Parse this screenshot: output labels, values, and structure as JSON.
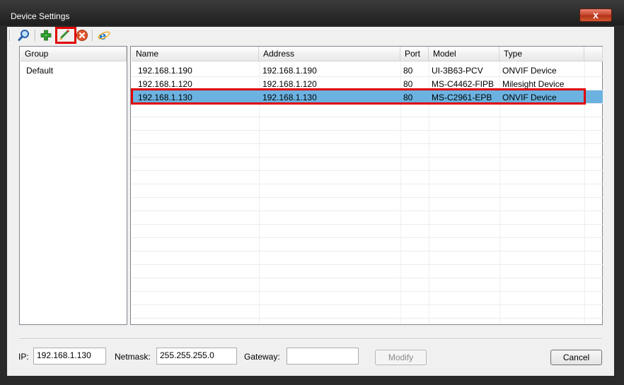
{
  "window": {
    "title": "Device Settings",
    "close_symbol": "x"
  },
  "toolbar": {
    "buttons": [
      {
        "name": "search-icon"
      },
      {
        "name": "add-icon"
      },
      {
        "name": "edit-icon"
      },
      {
        "name": "delete-icon"
      },
      {
        "name": "browser-icon"
      }
    ]
  },
  "group_panel": {
    "header": "Group",
    "items": [
      "Default"
    ]
  },
  "device_table": {
    "columns": [
      "Name",
      "Address",
      "Port",
      "Model",
      "Type"
    ],
    "rows": [
      {
        "name": "192.168.1.190",
        "address": "192.168.1.190",
        "port": "80",
        "model": "UI-3B63-PCV",
        "type": "ONVIF Device"
      },
      {
        "name": "192.168.1.120",
        "address": "192.168.1.120",
        "port": "80",
        "model": "MS-C4462-FIPB",
        "type": "Milesight Device"
      },
      {
        "name": "192.168.1.130",
        "address": "192.168.1.130",
        "port": "80",
        "model": "MS-C2961-EPB",
        "type": "ONVIF Device"
      }
    ],
    "selected_row": 2
  },
  "footer": {
    "ip_label": "IP:",
    "ip_value": "192.168.1.130",
    "netmask_label": "Netmask:",
    "netmask_value": "255.255.255.0",
    "gateway_label": "Gateway:",
    "gateway_value": "",
    "modify_label": "Modify",
    "cancel_label": "Cancel"
  },
  "colors": {
    "selection": "#6bb2e0",
    "highlight": "#e00000"
  }
}
